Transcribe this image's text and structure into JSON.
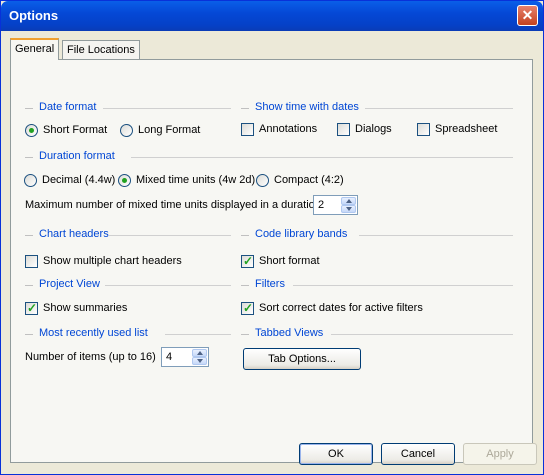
{
  "window": {
    "title": "Options"
  },
  "tabs": [
    {
      "label": "General"
    },
    {
      "label": "File Locations"
    }
  ],
  "sections": {
    "date_format": {
      "title": "Date format",
      "options": [
        {
          "label": "Short Format",
          "selected": true
        },
        {
          "label": "Long Format",
          "selected": false
        }
      ]
    },
    "show_time": {
      "title": "Show time with dates",
      "options": [
        {
          "label": "Annotations",
          "checked": false
        },
        {
          "label": "Dialogs",
          "checked": false
        },
        {
          "label": "Spreadsheet",
          "checked": false
        }
      ]
    },
    "duration_format": {
      "title": "Duration format",
      "options": [
        {
          "label": "Decimal (4.4w)",
          "selected": false
        },
        {
          "label": "Mixed time units (4w 2d)",
          "selected": true
        },
        {
          "label": "Compact (4:2)",
          "selected": false
        }
      ],
      "max_units_label": "Maximum number of mixed time units displayed in a duration",
      "max_units_value": "2"
    },
    "chart_headers": {
      "title": "Chart headers",
      "option": {
        "label": "Show multiple chart headers",
        "checked": false
      }
    },
    "code_library": {
      "title": "Code library bands",
      "option": {
        "label": "Short format",
        "checked": true
      }
    },
    "project_view": {
      "title": "Project View",
      "option": {
        "label": "Show summaries",
        "checked": true
      }
    },
    "filters": {
      "title": "Filters",
      "option": {
        "label": "Sort correct dates for active filters",
        "checked": true
      }
    },
    "mru": {
      "title": "Most recently used list",
      "items_label": "Number of items (up to 16)",
      "items_value": "4"
    },
    "tabbed_views": {
      "title": "Tabbed Views",
      "button_label": "Tab Options..."
    }
  },
  "buttons": {
    "ok": "OK",
    "cancel": "Cancel",
    "apply": "Apply"
  }
}
